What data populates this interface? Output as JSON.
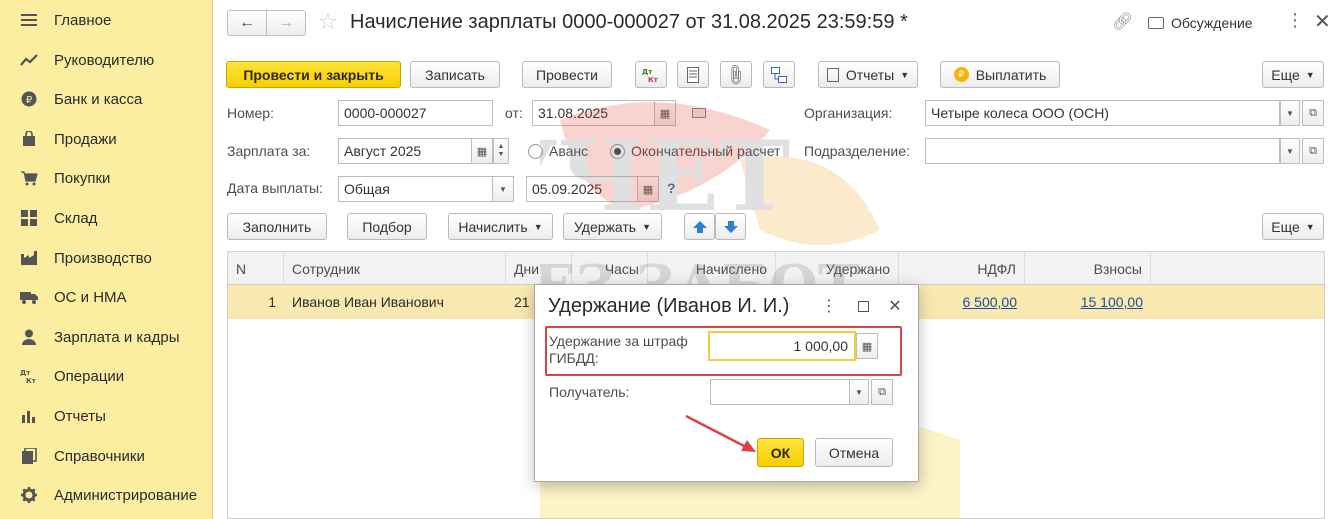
{
  "sidebar": {
    "items": [
      {
        "label": "Главное",
        "icon": "menu-icon"
      },
      {
        "label": "Руководителю",
        "icon": "trend-icon"
      },
      {
        "label": "Банк и касса",
        "icon": "coin-icon"
      },
      {
        "label": "Продажи",
        "icon": "bag-icon"
      },
      {
        "label": "Покупки",
        "icon": "cart-icon"
      },
      {
        "label": "Склад",
        "icon": "warehouse-icon"
      },
      {
        "label": "Производство",
        "icon": "factory-icon"
      },
      {
        "label": "ОС и НМА",
        "icon": "truck-icon"
      },
      {
        "label": "Зарплата и кадры",
        "icon": "person-icon"
      },
      {
        "label": "Операции",
        "icon": "dt-kt-icon"
      },
      {
        "label": "Отчеты",
        "icon": "bar-chart-icon"
      },
      {
        "label": "Справочники",
        "icon": "book-icon"
      },
      {
        "label": "Администрирование",
        "icon": "gear-icon"
      }
    ]
  },
  "header": {
    "title": "Начисление зарплаты 0000-000027 от 31.08.2025 23:59:59 *",
    "discussion": "Обсуждение"
  },
  "toolbar": {
    "post_close": "Провести и закрыть",
    "save": "Записать",
    "post": "Провести",
    "reports": "Отчеты",
    "pay": "Выплатить",
    "more": "Еще"
  },
  "form": {
    "number_label": "Номер:",
    "number_value": "0000-000027",
    "from_label": "от:",
    "date_value": "31.08.2025",
    "org_label": "Организация:",
    "org_value": "Четыре колеса ООО (ОСН)",
    "salary_for_label": "Зарплата за:",
    "salary_for_value": "Август 2025",
    "advance_label": "Аванс",
    "final_label": "Окончательный расчет",
    "division_label": "Подразделение:",
    "division_value": "",
    "pay_date_label": "Дата выплаты:",
    "pay_date_type": "Общая",
    "pay_date_value": "05.09.2025",
    "help": "?"
  },
  "table_toolbar": {
    "fill": "Заполнить",
    "pick": "Подбор",
    "accrue": "Начислить",
    "withhold": "Удержать",
    "more": "Еще"
  },
  "table": {
    "headers": [
      "N",
      "Сотрудник",
      "Дни",
      "Часы",
      "Начислено",
      "Удержано",
      "НДФЛ",
      "Взносы"
    ],
    "rows": [
      {
        "n": "1",
        "employee": "Иванов Иван Иванович",
        "days": "21",
        "ndfl": "6 500,00",
        "contrib": "15 100,00"
      }
    ]
  },
  "dialog": {
    "title": "Удержание (Иванов И. И.)",
    "fine_label": "Удержание за штраф ГИБДД:",
    "fine_value": "1 000,00",
    "recipient_label": "Получатель:",
    "recipient_value": "",
    "ok": "ОК",
    "cancel": "Отмена"
  },
  "watermark": {
    "line1": "УЧЕТ",
    "line2": "БЕЗ ЗАБОТ"
  },
  "colors": {
    "sidebar_bg": "#fbeea0",
    "primary_button": "#f6cf00",
    "selected_row": "#f9e9b0",
    "highlight": "#d64545",
    "link": "#1b4fa0"
  }
}
